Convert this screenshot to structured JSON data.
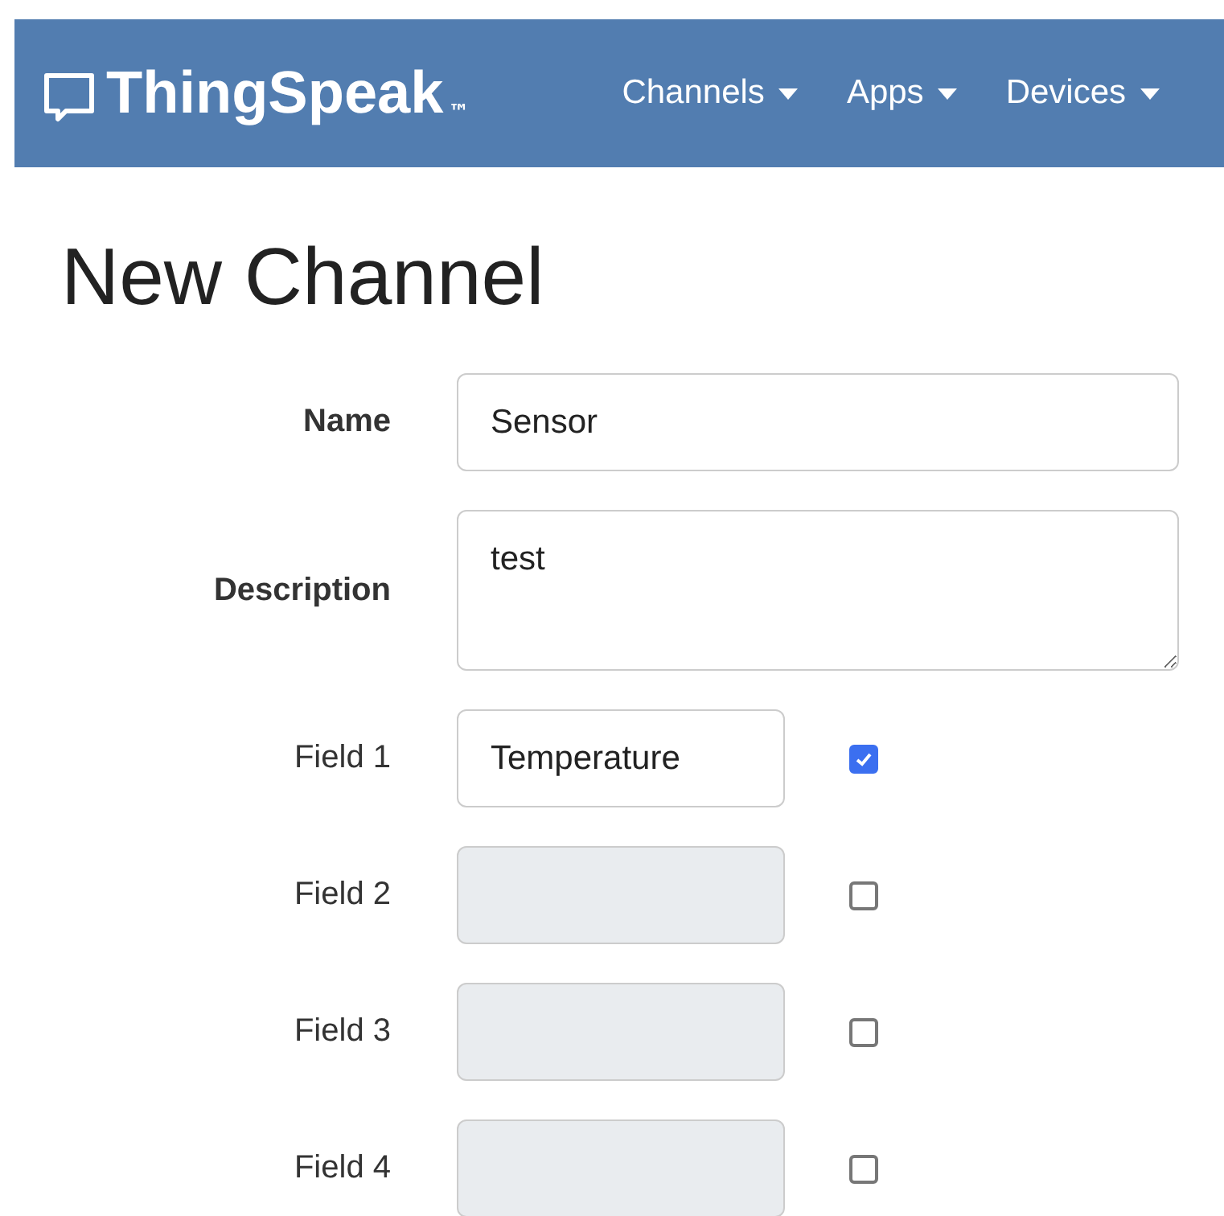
{
  "navbar": {
    "brand": "ThingSpeak",
    "trademark": "™",
    "menus": [
      {
        "label": "Channels"
      },
      {
        "label": "Apps"
      },
      {
        "label": "Devices"
      }
    ]
  },
  "page_title": "New Channel",
  "form": {
    "name": {
      "label": "Name",
      "value": "Sensor"
    },
    "description": {
      "label": "Description",
      "value": "test"
    },
    "fields": [
      {
        "label": "Field 1",
        "value": "Temperature",
        "checked": true
      },
      {
        "label": "Field 2",
        "checked": false
      },
      {
        "label": "Field 3",
        "checked": false
      },
      {
        "label": "Field 4",
        "checked": false
      }
    ]
  }
}
